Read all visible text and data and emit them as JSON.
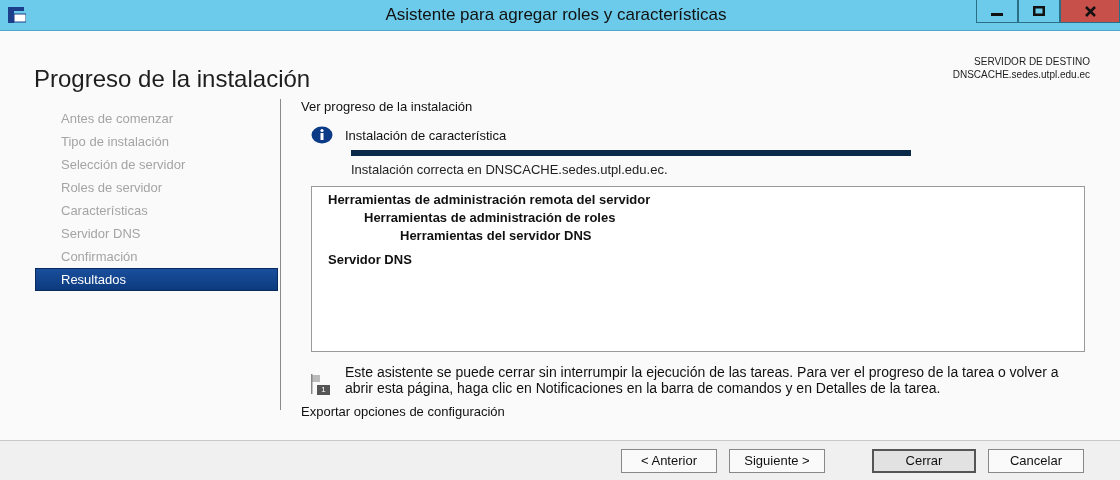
{
  "window": {
    "title": "Asistente para agregar roles y características"
  },
  "page_title": "Progreso de la instalación",
  "destination": {
    "label": "SERVIDOR DE DESTINO",
    "server": "DNSCACHE.sedes.utpl.edu.ec"
  },
  "sidebar": {
    "items": [
      {
        "label": "Antes de comenzar",
        "selected": false
      },
      {
        "label": "Tipo de instalación",
        "selected": false
      },
      {
        "label": "Selección de servidor",
        "selected": false
      },
      {
        "label": "Roles de servidor",
        "selected": false
      },
      {
        "label": "Características",
        "selected": false
      },
      {
        "label": "Servidor DNS",
        "selected": false
      },
      {
        "label": "Confirmación",
        "selected": false
      },
      {
        "label": "Resultados",
        "selected": true
      }
    ]
  },
  "section_title": "Ver progreso de la instalación",
  "progress": {
    "title": "Instalación de característica",
    "level": 1,
    "status": "Instalación correcta en DNSCACHE.sedes.utpl.edu.ec."
  },
  "results": [
    {
      "label": "Herramientas de administración remota del servidor",
      "children": [
        {
          "label": "Herramientas de administración de roles",
          "children": [
            {
              "label": "Herramientas del servidor DNS"
            }
          ]
        }
      ]
    },
    {
      "label": "Servidor DNS"
    }
  ],
  "notice": "Este asistente se puede cerrar sin interrumpir la ejecución de las tareas. Para ver el progreso de la tarea o volver a abrir esta página, haga clic en Notificaciones en la barra de comandos y en Detalles de la tarea.",
  "notice_badge": "1",
  "export_link": "Exportar opciones de configuración",
  "buttons": [
    {
      "label": "< Anterior",
      "default": false
    },
    {
      "label": "Siguiente >",
      "default": false
    },
    {
      "label": "Cerrar",
      "default": true
    },
    {
      "label": "Cancelar",
      "default": false
    }
  ]
}
